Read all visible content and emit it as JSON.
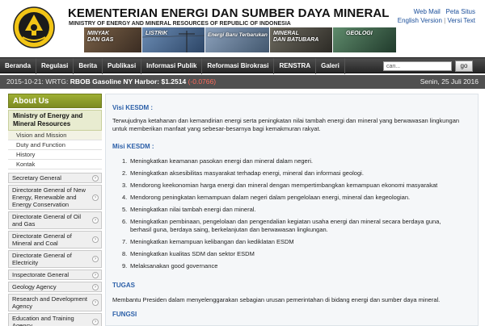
{
  "header": {
    "title": "KEMENTERIAN ENERGI DAN SUMBER DAYA MINERAL",
    "subtitle": "MINISTRY OF ENERGY AND MINERAL RESOURCES OF REPUBLIC OF INDONESIA",
    "links": {
      "web_mail": "Web Mail",
      "peta_situs": "Peta Situs",
      "english_version": "English Version",
      "versi_text": "Versi Text",
      "separator": "|"
    },
    "banner_tiles": [
      {
        "label": "MINYAK\nDAN GAS",
        "color": "#5a4636"
      },
      {
        "label": "LISTRIK",
        "color": "#3f5a7a"
      },
      {
        "label": "Energi Baru Terbarukan",
        "color": "#5c6f86"
      },
      {
        "label": "MINERAL\nDAN BATUBARA",
        "color": "#4b4a44"
      },
      {
        "label": "GEOLOGI",
        "color": "#4f6f5a"
      }
    ]
  },
  "nav": {
    "items": [
      "Beranda",
      "Regulasi",
      "Berita",
      "Publikasi",
      "Informasi Publik",
      "Reformasi Birokrasi",
      "RENSTRA",
      "Galeri"
    ],
    "search_value": "cari...",
    "search_button": "go"
  },
  "ticker": {
    "text": "2015-10-21: WRTG: ",
    "bold": "RBOB Gasoline NY Harbor: $1.2514",
    "change": " (-0.0766)",
    "date": "Senin, 25 Juli 2016"
  },
  "sidebar": {
    "header": "About Us",
    "section_title": "Ministry of Energy and Mineral Resources",
    "sub_items": [
      "Vision and Mission",
      "Duty and Function",
      "History",
      "Kontak"
    ],
    "items": [
      "Secretary General",
      "Directorate General of New Energy, Renewable and Energy Conservation",
      "Directorate General of Oil and Gas",
      "Directorate General of Mineral and Coal",
      "Directorate General of Electricity",
      "Inspectorate General",
      "Geology Agency",
      "Research and Development Agency",
      "Education and Training Agency"
    ],
    "arrow_glyph": "›"
  },
  "main": {
    "visi_heading": "Visi KESDM :",
    "visi_text": "Terwujudnya ketahanan dan kemandirian energi serta peningkatan nilai tambah energi dan mineral yang berwawasan lingkungan untuk memberikan manfaat yang sebesar-besarnya bagi kemakmuran rakyat.",
    "misi_heading": "Misi KESDM :",
    "misi_items": [
      "Meningkatkan keamanan pasokan energi dan mineral dalam negeri.",
      "Meningkatkan aksesibilitas masyarakat terhadap energi, mineral dan informasi geologi.",
      "Mendorong keekonomian harga energi dan mineral dengan mempertimbangkan kemampuan ekonomi masyarakat",
      "Mendorong peningkatan kemampuan dalam negeri dalam pengelolaan energi, mineral dan kegeologian.",
      "Meningkatkan nilai tambah energi dan mineral.",
      "Meningkatkan pembinaan, pengelolaan dan pengendalian kegiatan usaha energi dan mineral secara berdaya guna, berhasil guna, berdaya saing, berkelanjutan dan berwawasan lingkungan.",
      "Meningkatkan kemampuan kelibangan dan kediklatan ESDM",
      "Meningkatkan kualitas SDM dan sektor ESDM",
      "Melaksanakan good governance"
    ],
    "tugas_heading": "TUGAS",
    "tugas_text": "Membantu Presiden dalam menyelenggarakan sebagian urusan pemerintahan di bidang energi dan sumber daya mineral.",
    "fungsi_heading": "FUNGSI"
  }
}
